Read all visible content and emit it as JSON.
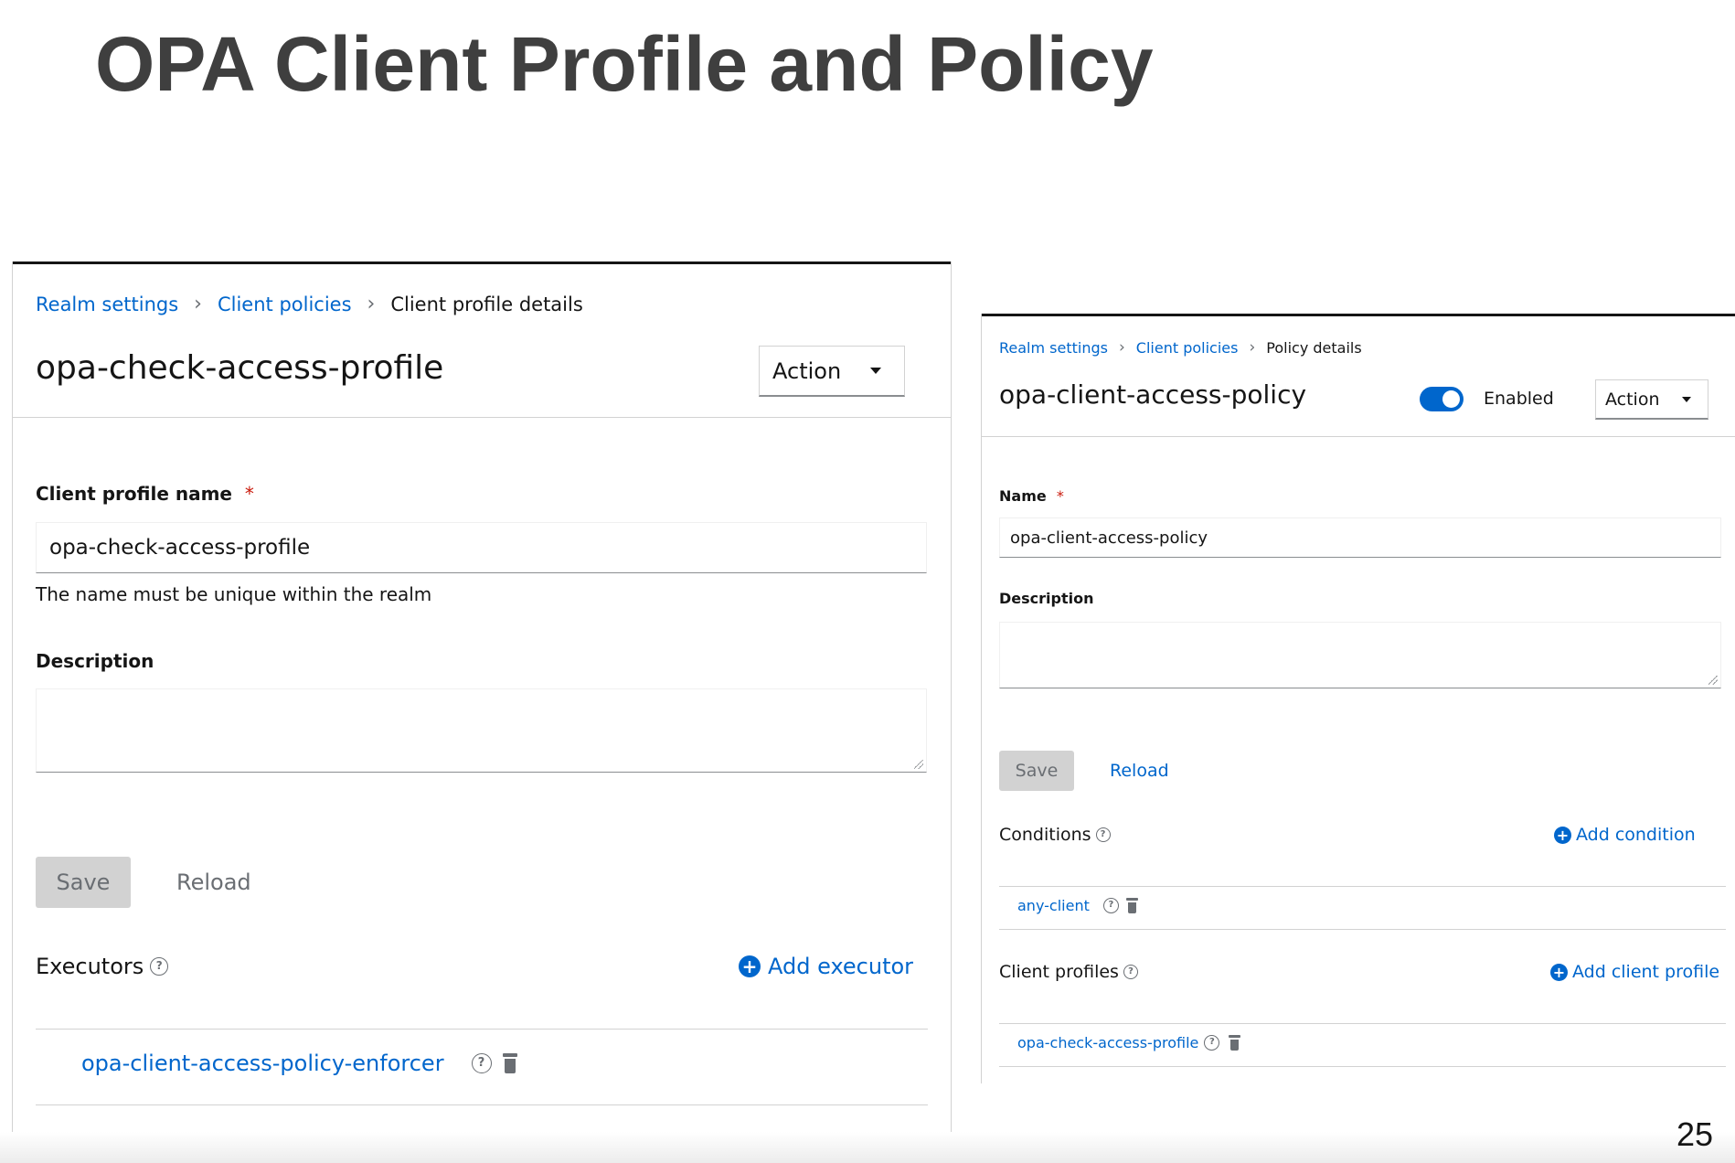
{
  "slide": {
    "title": "OPA Client Profile and Policy",
    "page_number": "25"
  },
  "profile_panel": {
    "breadcrumbs": [
      "Realm settings",
      "Client policies",
      "Client profile details"
    ],
    "title": "opa-check-access-profile",
    "action_label": "Action",
    "name_label": "Client profile name",
    "required_mark": "*",
    "name_value": "opa-check-access-profile",
    "name_helper": "The name must be unique within the realm",
    "description_label": "Description",
    "description_value": "",
    "save_label": "Save",
    "reload_label": "Reload",
    "executors_label": "Executors",
    "add_executor_label": "Add executor",
    "executors": [
      "opa-client-access-policy-enforcer"
    ]
  },
  "policy_panel": {
    "breadcrumbs": [
      "Realm settings",
      "Client policies",
      "Policy details"
    ],
    "title": "opa-client-access-policy",
    "enabled": true,
    "enabled_label": "Enabled",
    "action_label": "Action",
    "name_label": "Name",
    "required_mark": "*",
    "name_value": "opa-client-access-policy",
    "description_label": "Description",
    "description_value": "",
    "save_label": "Save",
    "reload_label": "Reload",
    "conditions_label": "Conditions",
    "add_condition_label": "Add condition",
    "conditions": [
      "any-client"
    ],
    "client_profiles_label": "Client profiles",
    "add_client_profile_label": "Add client profile",
    "client_profiles": [
      "opa-check-access-profile"
    ]
  },
  "colors": {
    "link": "#0066cc",
    "title": "#3f3f3f",
    "required": "#c9190b",
    "disabled_button": "#d2d2d2",
    "toggle_on": "#0066cc"
  },
  "icons": [
    "chevron-right-icon",
    "caret-down-icon",
    "help-icon",
    "plus-circle-icon",
    "trash-icon"
  ]
}
